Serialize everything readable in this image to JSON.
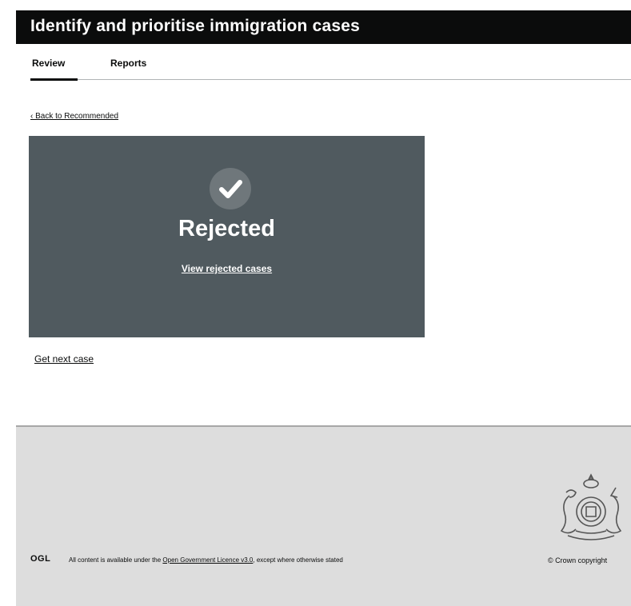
{
  "header": {
    "title": "Identify and prioritise immigration cases"
  },
  "tabs": [
    {
      "label": "Review",
      "active": true
    },
    {
      "label": "Reports",
      "active": false
    }
  ],
  "back_link": "‹ Back to Recommended",
  "panel": {
    "icon": "check-icon",
    "title": "Rejected",
    "link": "View rejected cases"
  },
  "next_case_link": "Get next case",
  "footer": {
    "ogl_label": "OGL",
    "licence_prefix": "All content is available under the",
    "licence_link": "Open Government Licence v3.0",
    "licence_suffix": ", except where otherwise stated",
    "copyright": "© Crown copyright"
  },
  "colors": {
    "header_bg": "#0b0c0c",
    "panel_bg": "#505a5f",
    "footer_bg": "#dddddd"
  }
}
